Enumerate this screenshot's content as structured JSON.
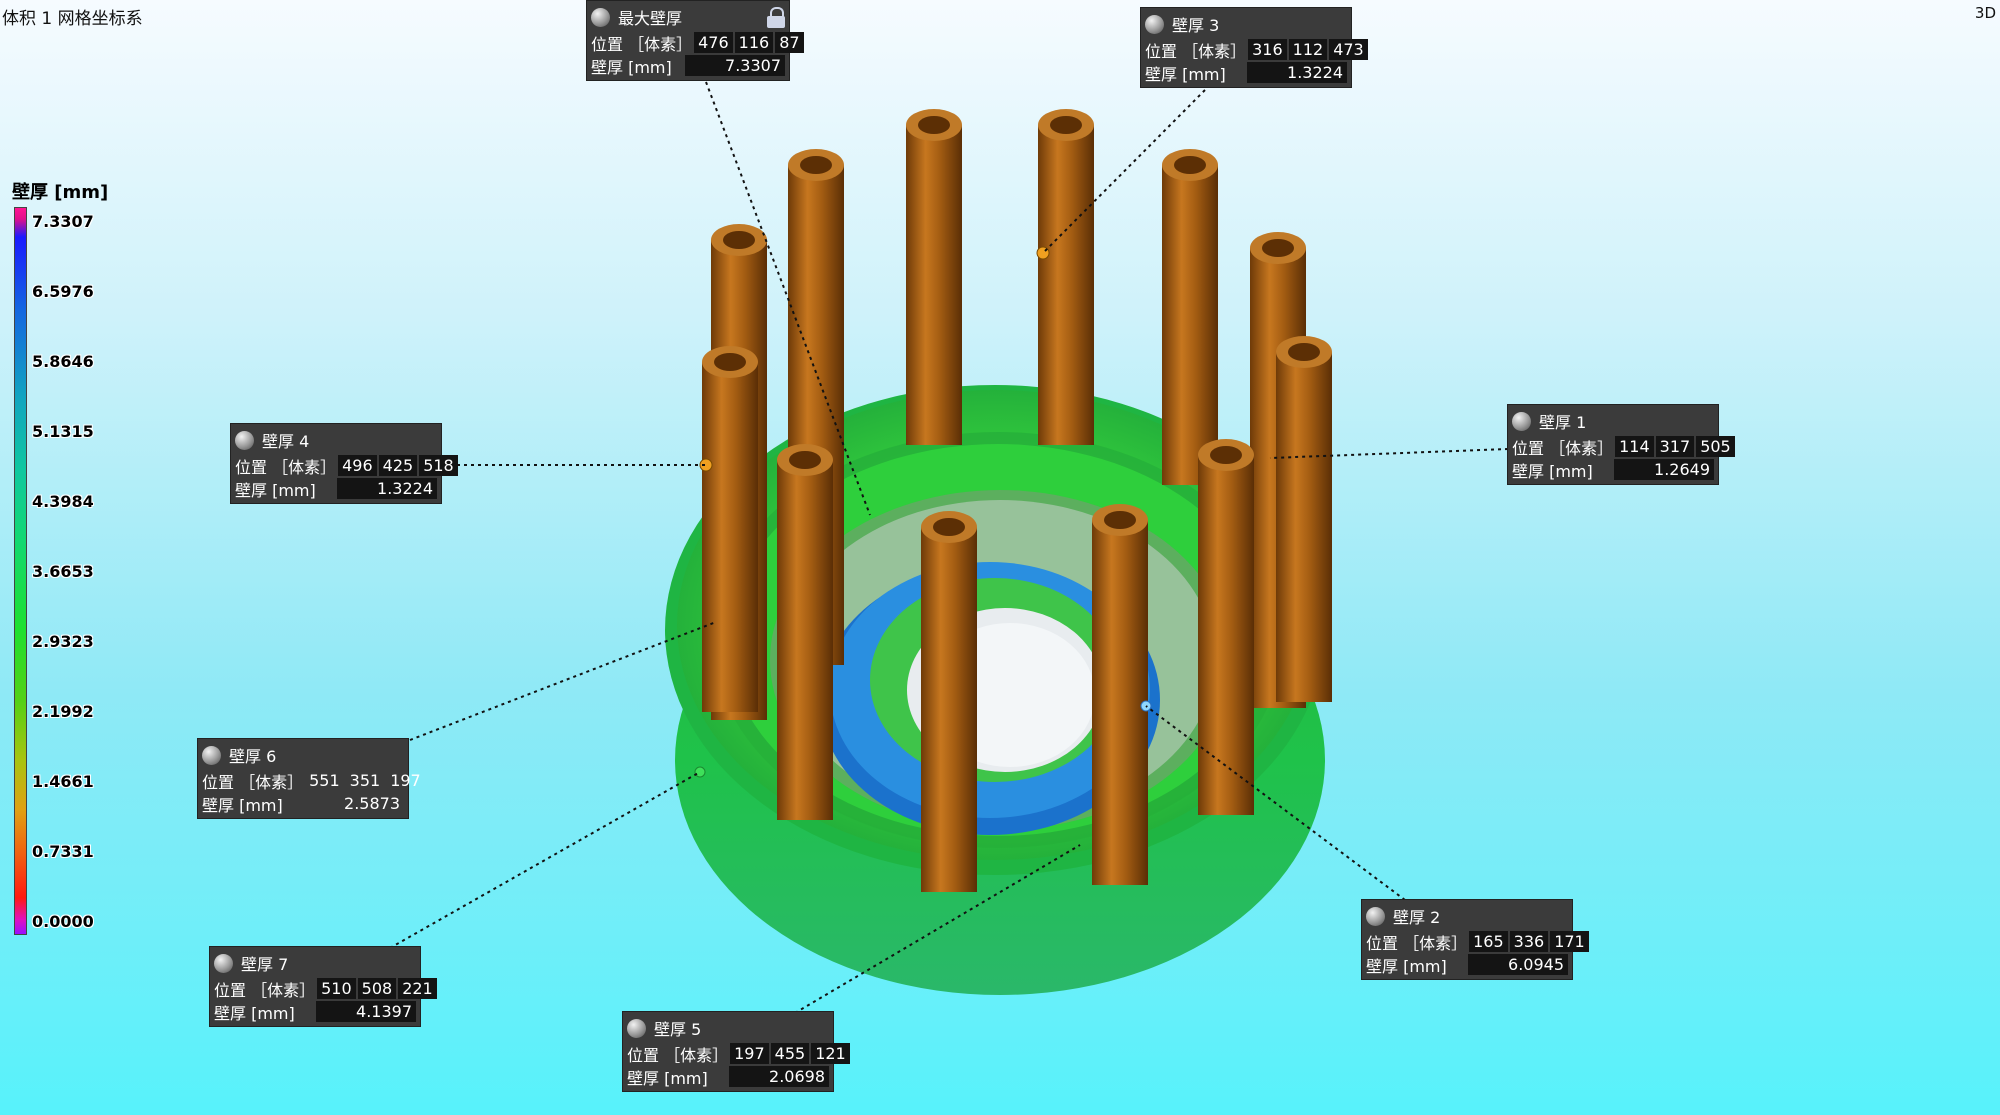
{
  "header": {
    "left_title": "体积 1 网格坐标系",
    "right_label": "3D"
  },
  "legend": {
    "title": "壁厚 [mm]",
    "ticks": [
      "7.3307",
      "6.5976",
      "5.8646",
      "5.1315",
      "4.3984",
      "3.6653",
      "2.9323",
      "2.1992",
      "1.4661",
      "0.7331",
      "0.0000"
    ]
  },
  "colors": {
    "pillar": "#a45d12",
    "ring_green": "#32c83a",
    "ring_blue": "#1b77d0",
    "annotation_bg": "#3b3b3b"
  },
  "annotations": [
    {
      "id": "max",
      "title": "最大壁厚",
      "locked": true,
      "pos_label": "位置 ［体素］",
      "pos": [
        "476",
        "116",
        "87"
      ],
      "th_label": "壁厚 [mm]",
      "value": "7.3307"
    },
    {
      "id": "t3",
      "title": "壁厚 3",
      "pos_label": "位置 ［体素］",
      "pos": [
        "316",
        "112",
        "473"
      ],
      "th_label": "壁厚 [mm]",
      "value": "1.3224"
    },
    {
      "id": "t4",
      "title": "壁厚 4",
      "pos_label": "位置 ［体素］",
      "pos": [
        "496",
        "425",
        "518"
      ],
      "th_label": "壁厚 [mm]",
      "value": "1.3224"
    },
    {
      "id": "t1",
      "title": "壁厚 1",
      "pos_label": "位置 ［体素］",
      "pos": [
        "114",
        "317",
        "505"
      ],
      "th_label": "壁厚 [mm]",
      "value": "1.2649"
    },
    {
      "id": "t6",
      "title": "壁厚 6",
      "pos_label": "位置 ［体素］",
      "pos": [
        "551",
        "351",
        "197"
      ],
      "th_label": "壁厚 [mm]",
      "value": "2.5873"
    },
    {
      "id": "t2",
      "title": "壁厚 2",
      "pos_label": "位置 ［体素］",
      "pos": [
        "165",
        "336",
        "171"
      ],
      "th_label": "壁厚 [mm]",
      "value": "6.0945"
    },
    {
      "id": "t7",
      "title": "壁厚 7",
      "pos_label": "位置 ［体素］",
      "pos": [
        "510",
        "508",
        "221"
      ],
      "th_label": "壁厚 [mm]",
      "value": "4.1397"
    },
    {
      "id": "t5",
      "title": "壁厚 5",
      "pos_label": "位置 ［体素］",
      "pos": [
        "197",
        "455",
        "121"
      ],
      "th_label": "壁厚 [mm]",
      "value": "2.0698"
    }
  ]
}
